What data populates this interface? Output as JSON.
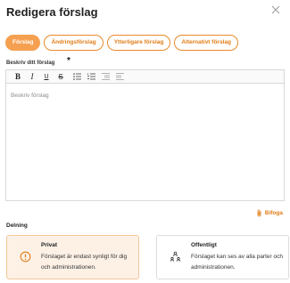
{
  "dialog": {
    "title": "Redigera förslag",
    "close_icon": "close-icon"
  },
  "tabs": [
    {
      "label": "Förslag",
      "active": true
    },
    {
      "label": "Ändringsförslag",
      "active": false
    },
    {
      "label": "Ytterligare förslag",
      "active": false
    },
    {
      "label": "Alternativt förslag",
      "active": false
    }
  ],
  "field": {
    "label": "Beskriv ditt förslag",
    "required_mark": "*",
    "placeholder": "Beskriv förslag"
  },
  "toolbar": [
    {
      "name": "bold",
      "icon": "bold-icon",
      "glyph": "B"
    },
    {
      "name": "italic",
      "icon": "italic-icon",
      "glyph": "I"
    },
    {
      "name": "underline",
      "icon": "underline-icon",
      "glyph": "U"
    },
    {
      "name": "strikethrough",
      "icon": "strikethrough-icon",
      "glyph": "S"
    },
    {
      "name": "bullet-list",
      "icon": "bullet-list-icon"
    },
    {
      "name": "numbered-list",
      "icon": "numbered-list-icon"
    },
    {
      "name": "outdent",
      "icon": "outdent-icon"
    },
    {
      "name": "indent",
      "icon": "indent-icon"
    }
  ],
  "attach": {
    "label": "Bifoga",
    "icon": "paperclip-icon"
  },
  "sharing": {
    "label": "Delning",
    "options": [
      {
        "title": "Privat",
        "description": "Förslaget är endast synligt för dig och administrationen.",
        "icon": "info-circle-icon",
        "selected": true
      },
      {
        "title": "Offentligt",
        "description": "Förslaget kan ses av alla parter och administrationen.",
        "icon": "people-network-icon",
        "selected": false
      }
    ]
  },
  "colors": {
    "accent": "#f5a050",
    "accent_text": "#e07c16",
    "selected_bg": "#fdf1e6"
  }
}
